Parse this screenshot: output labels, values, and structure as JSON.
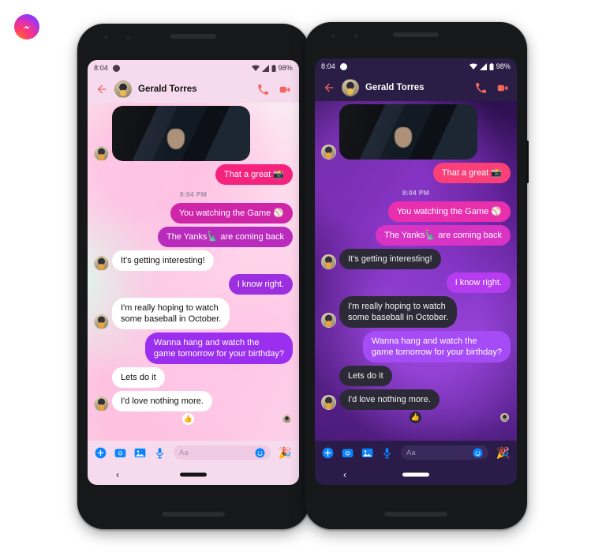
{
  "brand": {
    "name": "messenger-logo",
    "colors": {
      "start": "#5b4dff",
      "mid": "#e8339c",
      "end": "#ff6b2c"
    }
  },
  "status_bar": {
    "time": "8:04",
    "notification_icon": "messenger-notification-icon",
    "wifi_icon": "wifi-icon",
    "signal_icon": "cellular-signal-icon",
    "battery_icon": "battery-icon",
    "battery_label": "98%"
  },
  "header": {
    "back_icon": "back-arrow-icon",
    "avatar": "contact-avatar",
    "name": "Gerald Torres",
    "call_icon": "phone-call-icon",
    "video_icon": "video-call-icon",
    "light_accent": "#f4675f",
    "dark_accent": "#f4675f"
  },
  "thread": {
    "timestamp": "8:04 PM",
    "messages": [
      {
        "id": "m1",
        "kind": "photo",
        "side": "in",
        "avatar": true,
        "text": ""
      },
      {
        "id": "m2",
        "kind": "text",
        "side": "out",
        "text": "That a great 📸",
        "color": "b-hotpink"
      },
      {
        "id": "m3",
        "kind": "time",
        "text": "8:04 PM"
      },
      {
        "id": "m4",
        "kind": "text",
        "side": "out",
        "text": "You watching the Game ⚾",
        "color": "b-magenta"
      },
      {
        "id": "m5",
        "kind": "text",
        "side": "out",
        "text": "The Yanks🗽 are coming back",
        "color": "b-magenta2"
      },
      {
        "id": "m6",
        "kind": "text",
        "side": "in",
        "avatar": true,
        "text": "It's getting interesting!"
      },
      {
        "id": "m7",
        "kind": "text",
        "side": "out",
        "text": "I know right.",
        "color": "b-purple"
      },
      {
        "id": "m8",
        "kind": "text",
        "side": "in",
        "avatar": true,
        "text": "I'm really hoping to watch\nsome baseball in October."
      },
      {
        "id": "m9",
        "kind": "text",
        "side": "out",
        "text": "Wanna hang and watch the\ngame tomorrow for your birthday?",
        "color": "b-purple2"
      },
      {
        "id": "m10",
        "kind": "text",
        "side": "in",
        "avatar": false,
        "text": "Lets do it"
      },
      {
        "id": "m11",
        "kind": "text",
        "side": "in",
        "avatar": true,
        "text": "I'd love nothing more."
      }
    ],
    "reaction": "👍",
    "seen_avatar": "seen-by-avatar"
  },
  "composer": {
    "plus_icon": "add-attachment-icon",
    "camera_icon": "camera-icon",
    "gallery_icon": "gallery-icon",
    "mic_icon": "microphone-icon",
    "input_placeholder": "Aa",
    "input_value": "",
    "emoji_icon": "emoji-smiley-icon",
    "sticker_icon": "party-popper-sticker",
    "sticker_glyph": "🎉",
    "accent": "#0a84ff"
  },
  "nav_bar": {
    "back_glyph": "‹",
    "back_icon": "android-back-icon",
    "home_indicator": "home-indicator-pill"
  },
  "phones": [
    {
      "id": "phone-light",
      "theme": "light",
      "label": "light-mode-phone"
    },
    {
      "id": "phone-right",
      "theme": "dark",
      "label": "dark-mode-phone"
    }
  ]
}
